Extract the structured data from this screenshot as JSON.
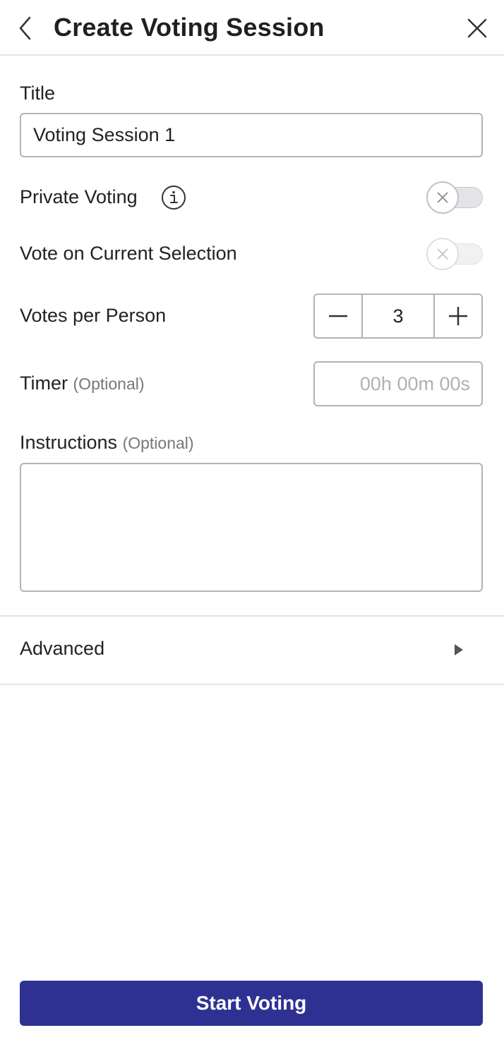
{
  "header": {
    "title": "Create Voting Session",
    "back_icon": "chevron-left-icon",
    "close_icon": "close-icon"
  },
  "form": {
    "title_label": "Title",
    "title_value": "Voting Session 1",
    "private_voting_label": "Private Voting",
    "private_voting_on": false,
    "info_icon": "info-icon",
    "current_selection_label": "Vote on Current Selection",
    "current_selection_on": false,
    "current_selection_disabled": true,
    "votes_label": "Votes per Person",
    "votes_value": "3",
    "timer_label": "Timer",
    "timer_optional": "(Optional)",
    "timer_placeholder": "00h 00m 00s",
    "instructions_label": "Instructions",
    "instructions_optional": "(Optional)",
    "instructions_value": ""
  },
  "advanced": {
    "label": "Advanced",
    "arrow_icon": "triangle-right-icon"
  },
  "footer": {
    "start_label": "Start Voting"
  },
  "colors": {
    "primary": "#2f3192",
    "border": "#b3b3b8",
    "divider": "#e3e3e6"
  }
}
